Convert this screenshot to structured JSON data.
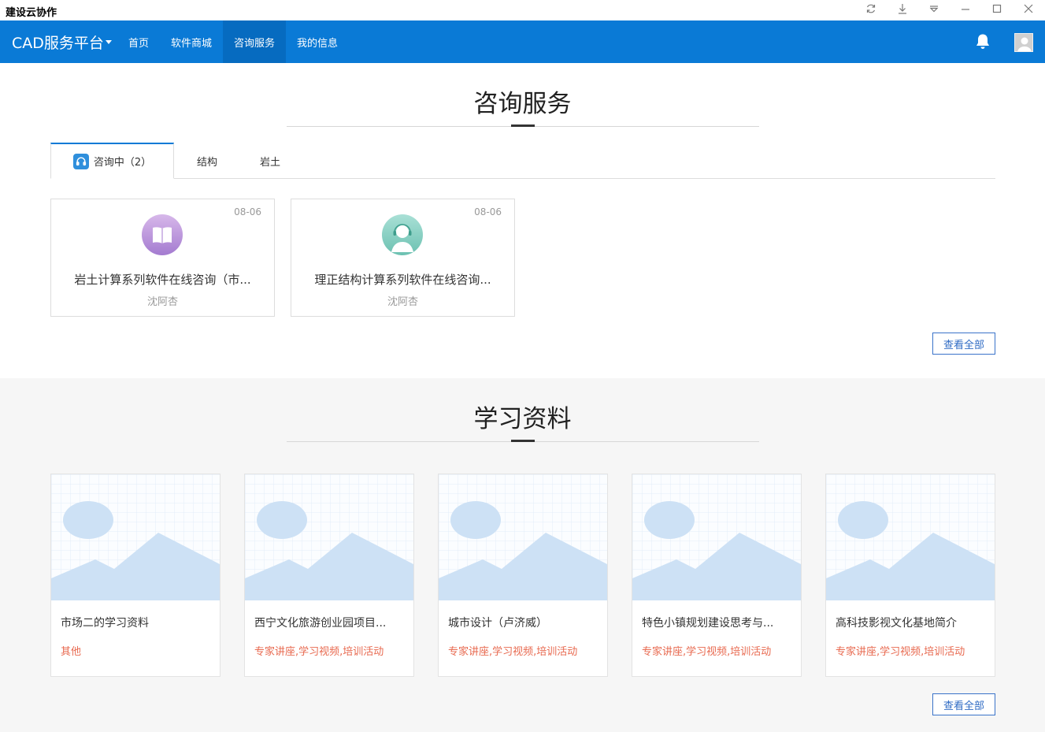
{
  "window": {
    "title": "建设云协作"
  },
  "navbar": {
    "brand": "CAD服务平台",
    "items": [
      {
        "label": "首页"
      },
      {
        "label": "软件商城"
      },
      {
        "label": "咨询服务",
        "active": true
      },
      {
        "label": "我的信息"
      }
    ]
  },
  "consult": {
    "title": "咨询服务",
    "tabs": [
      {
        "label": "咨询中（2）"
      },
      {
        "label": "结构"
      },
      {
        "label": "岩土"
      }
    ],
    "cards": [
      {
        "date": "08-06",
        "title": "岩土计算系列软件在线咨询（市...",
        "author": "沈阿杏",
        "icon": "book-icon"
      },
      {
        "date": "08-06",
        "title": "理正结构计算系列软件在线咨询...",
        "author": "沈阿杏",
        "icon": "support-agent-icon"
      }
    ],
    "view_all": "查看全部"
  },
  "learning": {
    "title": "学习资料",
    "cards": [
      {
        "title": "市场二的学习资料",
        "tags": "其他"
      },
      {
        "title": "西宁文化旅游创业园项目...",
        "tags": "专家讲座,学习视频,培训活动"
      },
      {
        "title": "城市设计（卢济威）",
        "tags": "专家讲座,学习视频,培训活动"
      },
      {
        "title": "特色小镇规划建设思考与...",
        "tags": "专家讲座,学习视频,培训活动"
      },
      {
        "title": "高科技影视文化基地简介",
        "tags": "专家讲座,学习视频,培训活动"
      }
    ],
    "view_all": "查看全部"
  },
  "colors": {
    "nav": "#0a7ad6",
    "accent": "#3a73c9",
    "tag": "#e8694f"
  }
}
